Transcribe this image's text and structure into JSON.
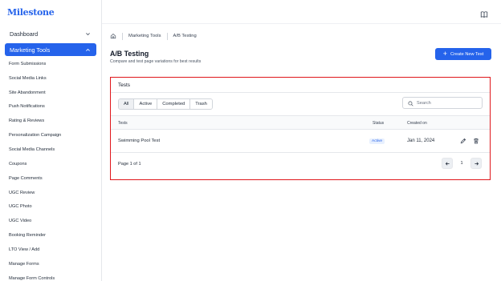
{
  "brand": {
    "logo_text": "Milestone",
    "accent": "#2563eb",
    "highlight": "#e0161b"
  },
  "sidebar": {
    "dashboard_label": "Dashboard",
    "marketing_tools_label": "Marketing Tools",
    "items": [
      {
        "label": "Form Submissions"
      },
      {
        "label": "Social Media Links"
      },
      {
        "label": "Site Abandonment"
      },
      {
        "label": "Push Notifications"
      },
      {
        "label": "Rating & Reviews"
      },
      {
        "label": "Personalization Campaign"
      },
      {
        "label": "Social Media Channels"
      },
      {
        "label": "Coupons"
      },
      {
        "label": "Page Comments"
      },
      {
        "label": "UGC Review"
      },
      {
        "label": "UGC Photo"
      },
      {
        "label": "UGC Video"
      },
      {
        "label": "Booking Reminder"
      },
      {
        "label": "LTO View / Add"
      },
      {
        "label": "Manage Forms"
      },
      {
        "label": "Manage Form Controls"
      }
    ]
  },
  "breadcrumb": {
    "items": [
      "Marketing Tools",
      "A/B Testing"
    ]
  },
  "page": {
    "title": "A/B Testing",
    "subtitle": "Compare and test page variations for best results",
    "create_button": "Create New Test"
  },
  "tests_card": {
    "title": "Tests",
    "tabs": [
      "All",
      "Active",
      "Completed",
      "Trash"
    ],
    "active_tab": "All",
    "search_placeholder": "Search",
    "columns": {
      "tests": "Tests",
      "status": "Status",
      "created_on": "Created on"
    },
    "rows": [
      {
        "name": "Swimming Pool Test",
        "status": "Active",
        "created_on": "Jan 11, 2024"
      }
    ],
    "pagination": {
      "text": "Page 1 of 1",
      "current": "1"
    }
  }
}
